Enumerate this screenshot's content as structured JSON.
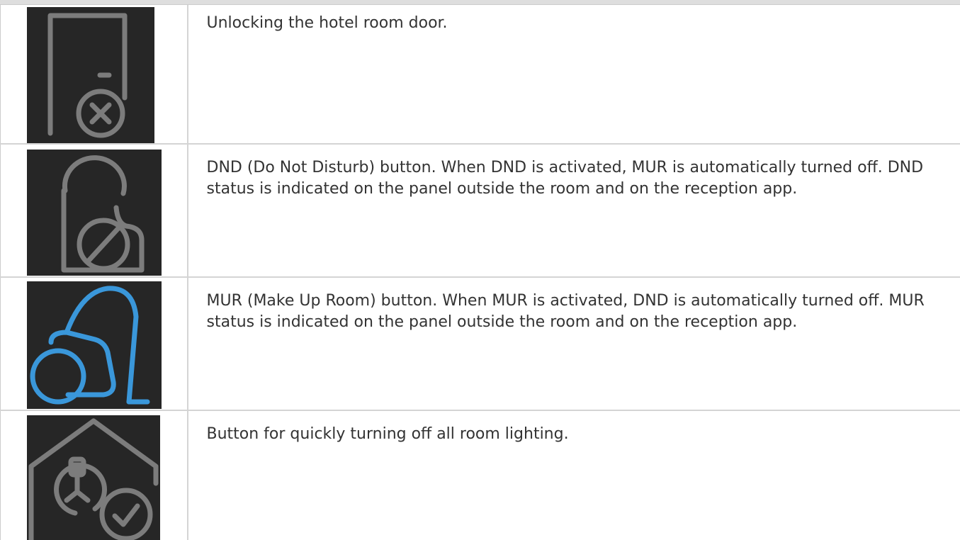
{
  "rows": [
    {
      "icon": "door-unlock-icon",
      "icon_color": "#7c7c7c",
      "description": "Unlocking the hotel room door."
    },
    {
      "icon": "do-not-disturb-hanger-icon",
      "icon_color": "#7c7c7c",
      "description": "DND (Do Not Disturb) button. When DND is activated, MUR is automatically turned off. DND status is indicated on the panel outside the room and on the reception app."
    },
    {
      "icon": "vacuum-cleaner-icon",
      "icon_color": "#3a97da",
      "description": "MUR (Make Up Room) button. When MUR is activated, DND is automatically turned off. MUR status is indicated on the panel outside the room and on the reception app."
    },
    {
      "icon": "house-lightbulb-check-icon",
      "icon_color": "#7c7c7c",
      "description": "Button for quickly turning off all room lighting."
    }
  ],
  "colors": {
    "icon_background": "#262626",
    "border": "#d4d4d4",
    "text": "#333333"
  }
}
